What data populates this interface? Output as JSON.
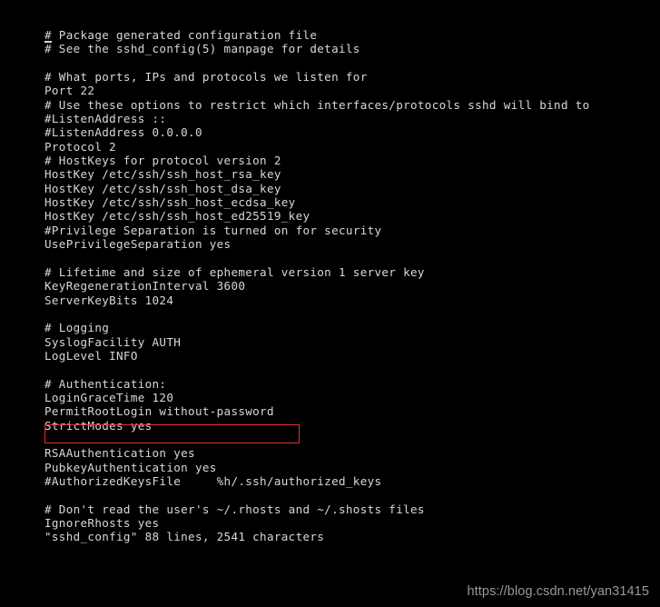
{
  "terminal": {
    "background_color": "#000000",
    "text_color": "#d8d8d8",
    "lines": [
      "# Package generated configuration file",
      "# See the sshd_config(5) manpage for details",
      "",
      "# What ports, IPs and protocols we listen for",
      "Port 22",
      "# Use these options to restrict which interfaces/protocols sshd will bind to",
      "#ListenAddress ::",
      "#ListenAddress 0.0.0.0",
      "Protocol 2",
      "# HostKeys for protocol version 2",
      "HostKey /etc/ssh/ssh_host_rsa_key",
      "HostKey /etc/ssh/ssh_host_dsa_key",
      "HostKey /etc/ssh/ssh_host_ecdsa_key",
      "HostKey /etc/ssh/ssh_host_ed25519_key",
      "#Privilege Separation is turned on for security",
      "UsePrivilegeSeparation yes",
      "",
      "# Lifetime and size of ephemeral version 1 server key",
      "KeyRegenerationInterval 3600",
      "ServerKeyBits 1024",
      "",
      "# Logging",
      "SyslogFacility AUTH",
      "LogLevel INFO",
      "",
      "# Authentication:",
      "LoginGraceTime 120",
      "PermitRootLogin without-password",
      "StrictModes yes",
      "",
      "RSAAuthentication yes",
      "PubkeyAuthentication yes",
      "#AuthorizedKeysFile     %h/.ssh/authorized_keys",
      "",
      "# Don't read the user's ~/.rhosts and ~/.shosts files",
      "IgnoreRhosts yes"
    ],
    "status_line": "\"sshd_config\" 88 lines, 2541 characters",
    "cursor": {
      "line_index": 0,
      "column_index": 0,
      "character": "#"
    }
  },
  "annotation": {
    "highlight_box": {
      "target_line": "PermitRootLogin without-password",
      "color": "#e8322a"
    }
  },
  "watermark": {
    "text": "https://blog.csdn.net/yan31415",
    "color": "#9a9a9a"
  }
}
